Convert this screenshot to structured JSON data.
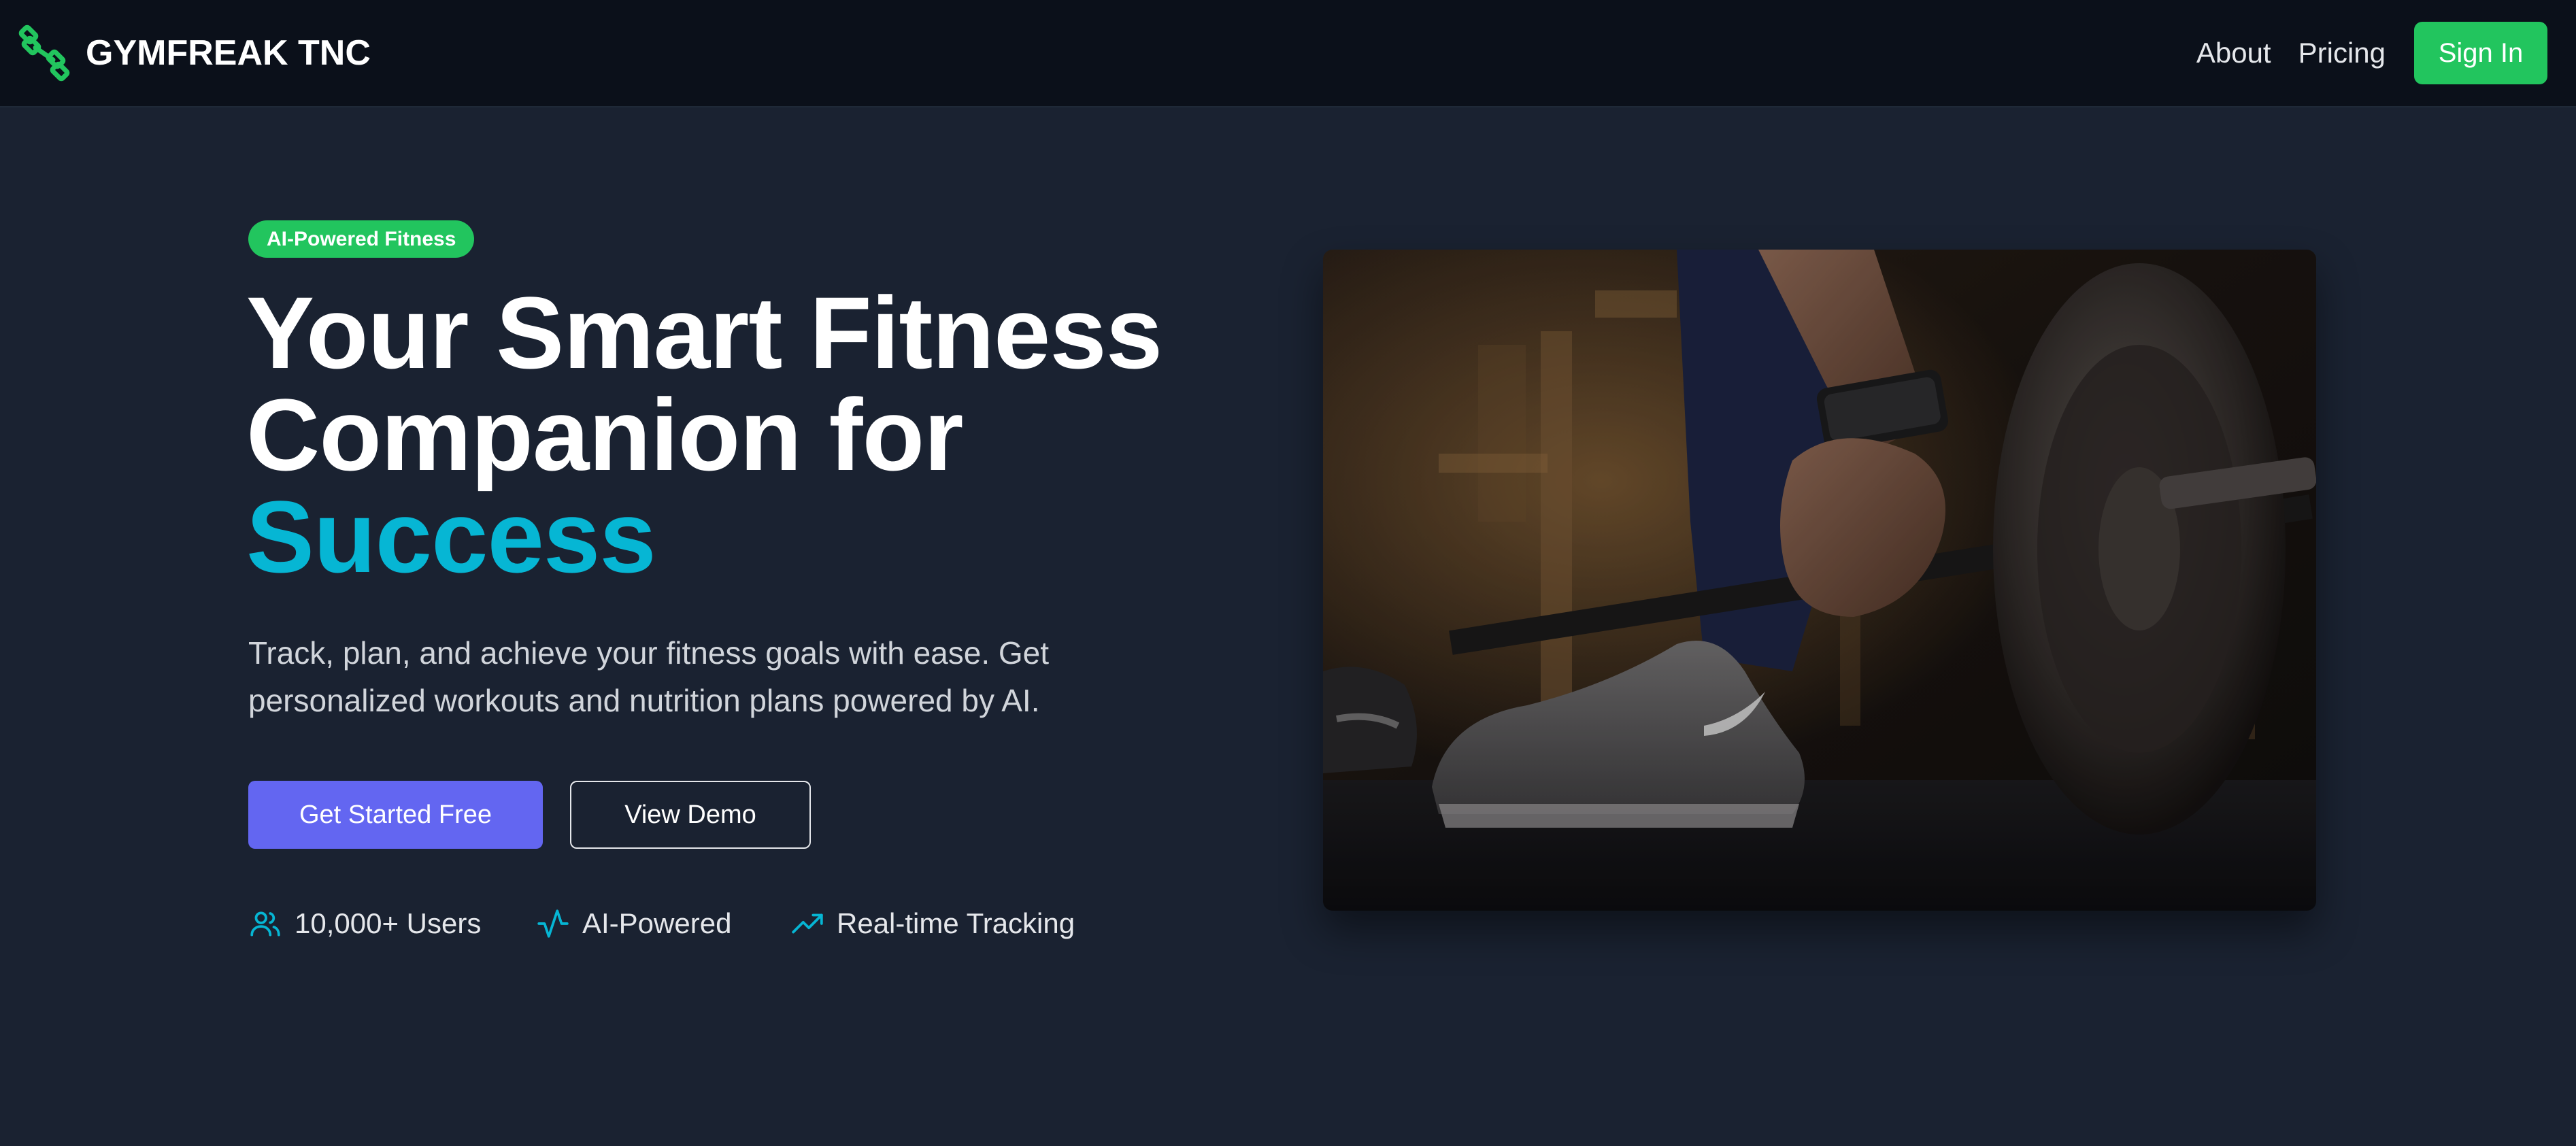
{
  "header": {
    "brand_name": "GYMFREAK TNC",
    "nav": {
      "about": "About",
      "pricing": "Pricing",
      "sign_in": "Sign In"
    }
  },
  "hero": {
    "badge": "AI-Powered Fitness",
    "headline": {
      "line1": "Your Smart Fitness",
      "line2": "Companion for",
      "line3": "Success"
    },
    "subtext": {
      "line1": "Track, plan, and achieve your fitness goals with ease. Get",
      "line2": "personalized workouts and nutrition plans powered by AI."
    },
    "buttons": {
      "primary": "Get Started Free",
      "secondary": "View Demo"
    },
    "stats": [
      {
        "icon": "users-icon",
        "label": "10,000+ Users"
      },
      {
        "icon": "activity-icon",
        "label": "AI-Powered"
      },
      {
        "icon": "trending-up-icon",
        "label": "Real-time Tracking"
      }
    ]
  },
  "colors": {
    "background": "#1a2231",
    "topbar": "#0b101a",
    "brand_green": "#22c55e",
    "accent_cyan": "#06b6d4",
    "primary_indigo": "#6366f1"
  }
}
